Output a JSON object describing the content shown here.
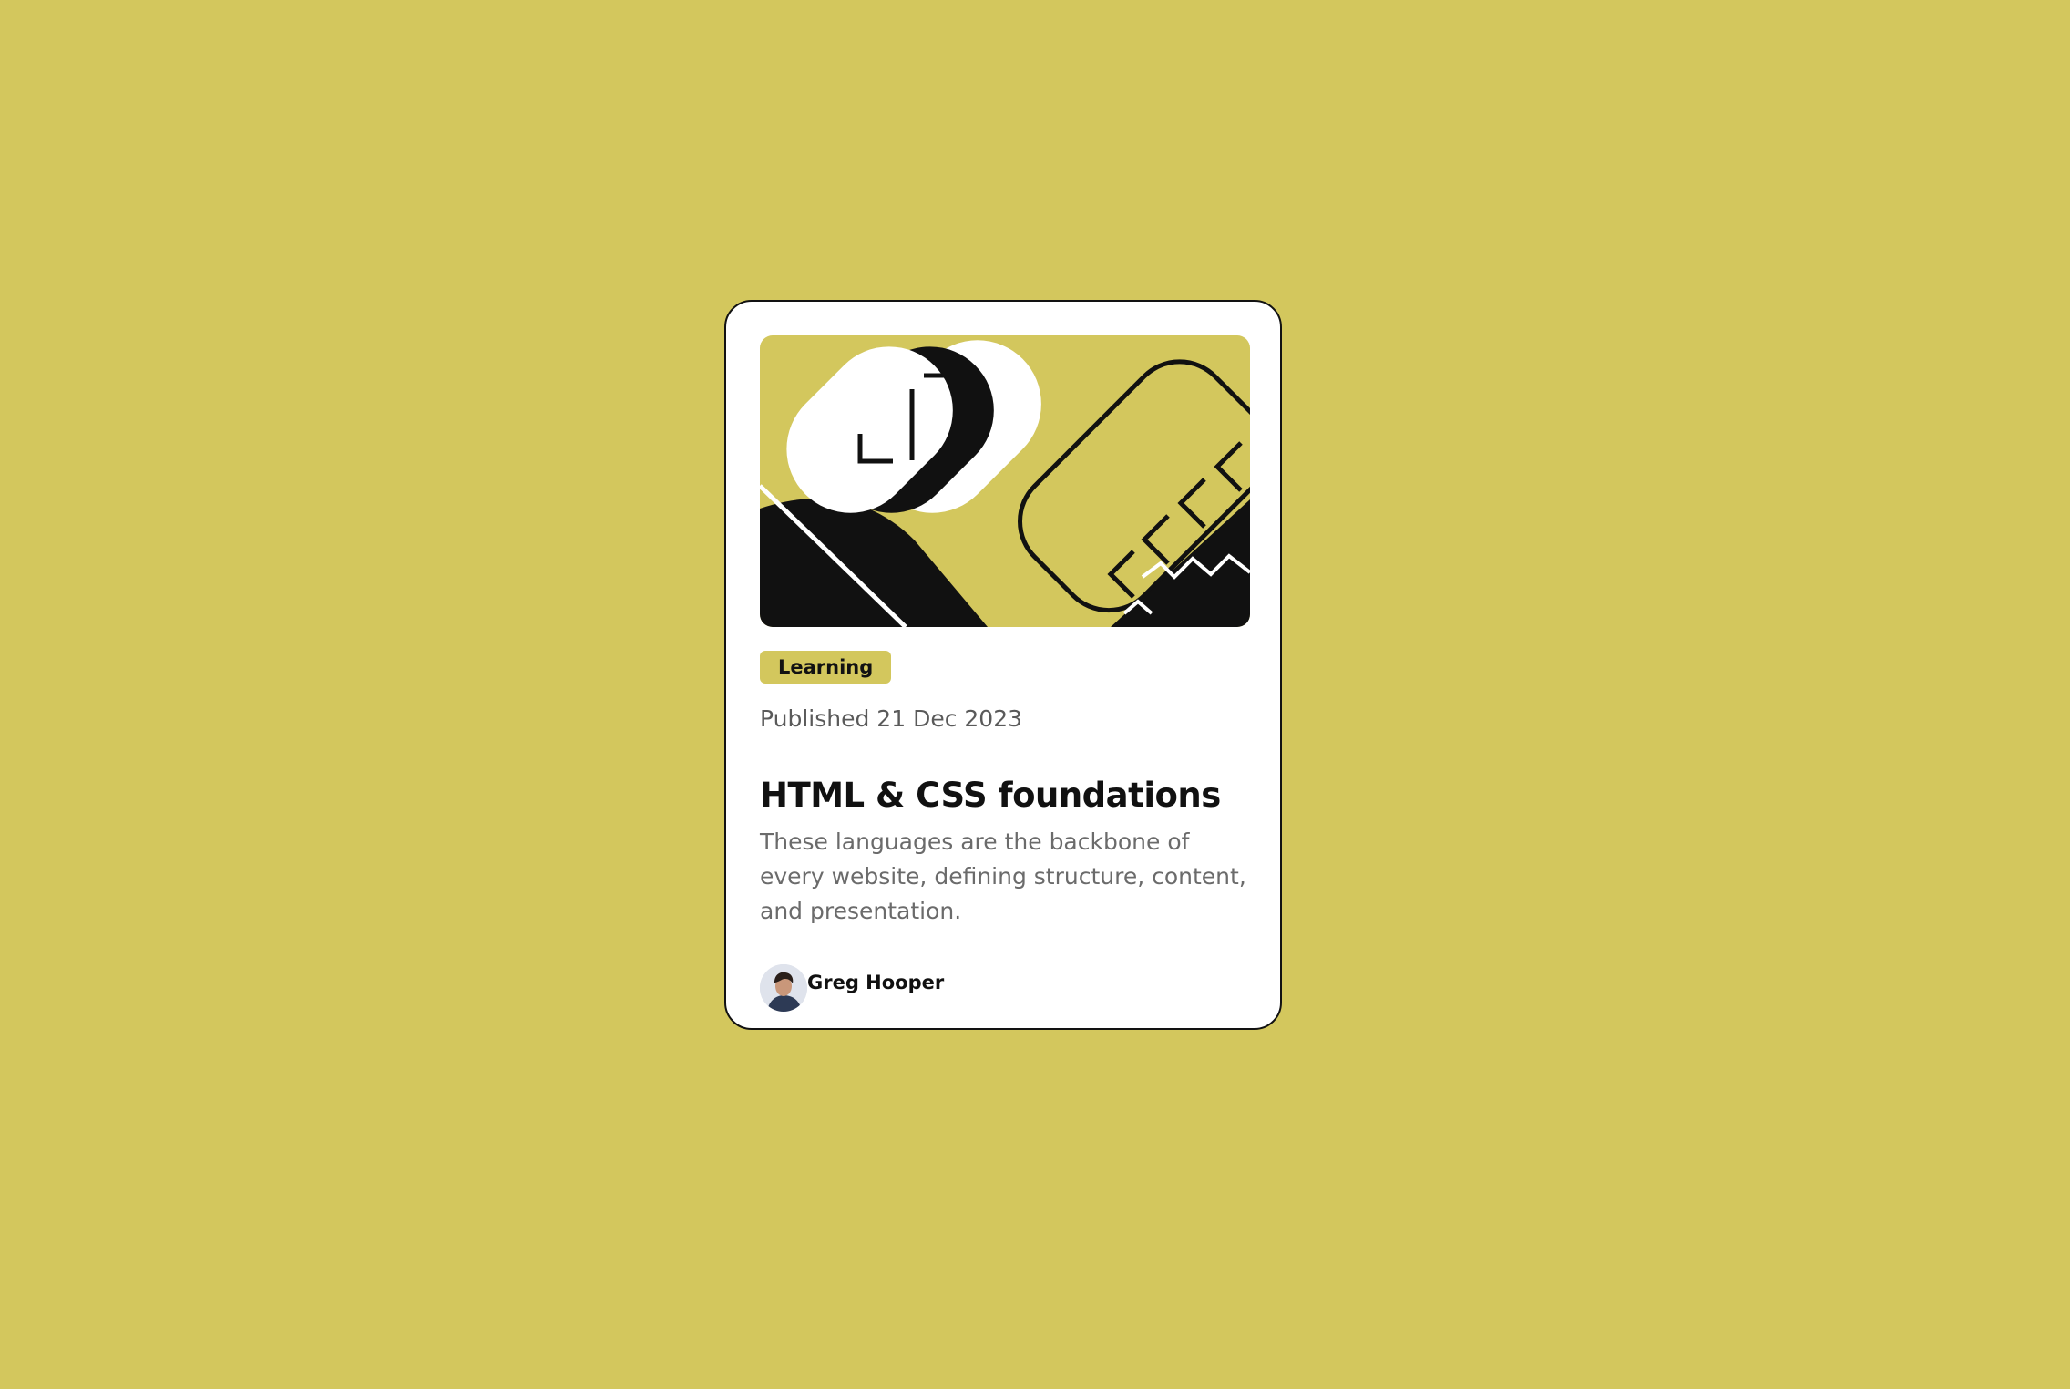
{
  "theme": {
    "background_color": "#d3c75d",
    "card_color": "#ffffff",
    "text_dark": "#111111",
    "text_muted": "#6b6b6b"
  },
  "card": {
    "hero_image": "abstract-illustration",
    "tag": "Learning",
    "published": "Published 21 Dec 2023",
    "title": "HTML & CSS foundations",
    "description": "These languages are the backbone of every website, defining structure, content, and presentation.",
    "author": {
      "name": "Greg Hooper",
      "avatar": "author-avatar"
    }
  }
}
